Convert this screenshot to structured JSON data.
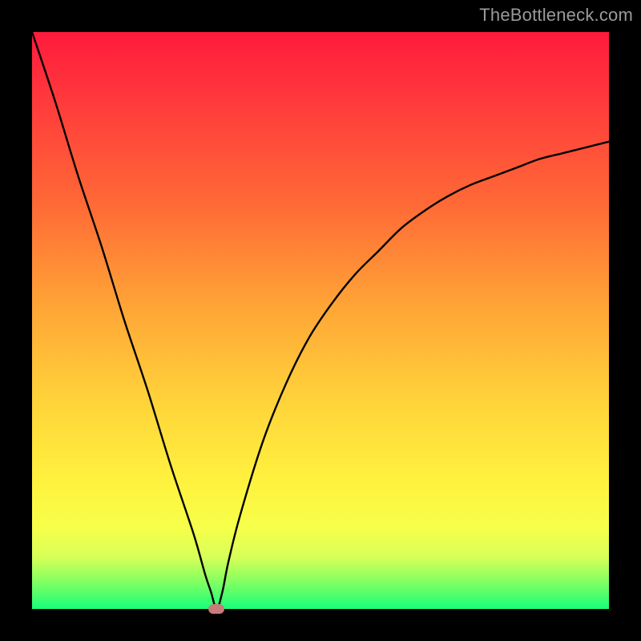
{
  "watermark": {
    "text": "TheBottleneck.com"
  },
  "colors": {
    "curve": "#000000",
    "marker": "#c97b7b",
    "gradient_top": "#ff1a3c",
    "gradient_bottom": "#17ff7c",
    "frame": "#000000"
  },
  "chart_data": {
    "type": "line",
    "title": "",
    "xlabel": "",
    "ylabel": "",
    "xlim": [
      0,
      100
    ],
    "ylim": [
      0,
      100
    ],
    "grid": false,
    "legend": false,
    "annotations": [
      "TheBottleneck.com"
    ],
    "marker": {
      "x": 32,
      "y": 0,
      "color": "#c97b7b"
    },
    "series": [
      {
        "name": "bottleneck-curve",
        "color": "#000000",
        "x": [
          0,
          4,
          8,
          12,
          16,
          20,
          24,
          28,
          30,
          31,
          32,
          33,
          34,
          36,
          40,
          44,
          48,
          52,
          56,
          60,
          64,
          68,
          72,
          76,
          80,
          84,
          88,
          92,
          96,
          100
        ],
        "y": [
          100,
          88,
          75,
          63,
          50,
          38,
          25,
          13,
          6,
          3,
          0,
          3,
          8,
          16,
          29,
          39,
          47,
          53,
          58,
          62,
          66,
          69,
          71.5,
          73.5,
          75,
          76.5,
          78,
          79,
          80,
          81
        ]
      }
    ]
  }
}
